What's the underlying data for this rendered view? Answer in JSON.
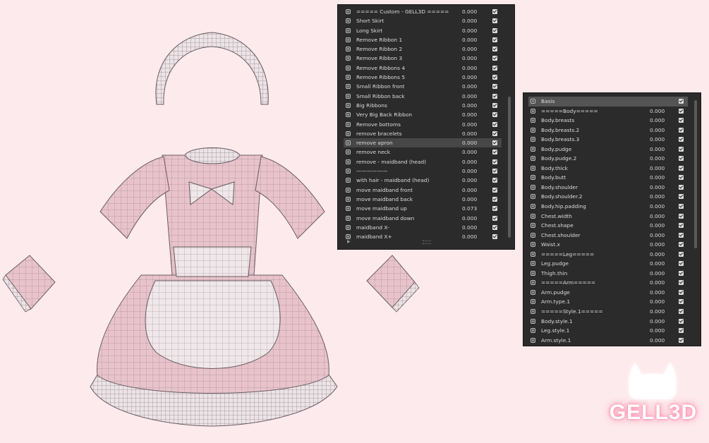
{
  "panel_left": {
    "rows": [
      {
        "name": "===== Custom - GELL3D =====",
        "value": "0.000"
      },
      {
        "name": "Short Skirt",
        "value": "0.000"
      },
      {
        "name": "Long Skirt",
        "value": "0.000"
      },
      {
        "name": "Remove Ribbon 1",
        "value": "0.000"
      },
      {
        "name": "Remove Ribbon 2",
        "value": "0.000"
      },
      {
        "name": "Remove Ribbon 3",
        "value": "0.000"
      },
      {
        "name": "Remove Ribbons 4",
        "value": "0.000"
      },
      {
        "name": "Remove Ribbons 5",
        "value": "0.000"
      },
      {
        "name": "Small Ribbon front",
        "value": "0.000"
      },
      {
        "name": "Small Ribbon back",
        "value": "0.000"
      },
      {
        "name": "Big Ribbons",
        "value": "0.000"
      },
      {
        "name": "Very Big Back Ribbon",
        "value": "0.000"
      },
      {
        "name": "Remove bottoms",
        "value": "0.000"
      },
      {
        "name": "remove bracelets",
        "value": "0.000"
      },
      {
        "name": "remove apron",
        "value": "0.000",
        "highlight": true
      },
      {
        "name": "remove neck",
        "value": "0.000"
      },
      {
        "name": "remove - maidband (head)",
        "value": "0.000"
      },
      {
        "name": "——————",
        "value": "0.000"
      },
      {
        "name": "with hair - maidband (head)",
        "value": "0.000"
      },
      {
        "name": "move maidband front",
        "value": "0.000"
      },
      {
        "name": "move maidband back",
        "value": "0.000"
      },
      {
        "name": "move maidband up",
        "value": "0.073"
      },
      {
        "name": "move maidband down",
        "value": "0.000"
      },
      {
        "name": "maidband X-",
        "value": "0.000"
      },
      {
        "name": "maidband X+",
        "value": "0.000"
      }
    ]
  },
  "panel_right": {
    "rows": [
      {
        "name": "Basis",
        "value": "",
        "selected": true
      },
      {
        "name": "=====Body=====",
        "value": "0.000"
      },
      {
        "name": "Body.breasts",
        "value": "0.000"
      },
      {
        "name": "Body.breasts.2",
        "value": "0.000"
      },
      {
        "name": "Body.breasts.3",
        "value": "0.000"
      },
      {
        "name": "Body.pudge",
        "value": "0.000"
      },
      {
        "name": "Body.pudge.2",
        "value": "0.000"
      },
      {
        "name": "Body.thick",
        "value": "0.000"
      },
      {
        "name": "Body.butt",
        "value": "0.000"
      },
      {
        "name": "Body.shoulder",
        "value": "0.000"
      },
      {
        "name": "Body.shoulder.2",
        "value": "0.000"
      },
      {
        "name": "Body.hip.padding",
        "value": "0.000"
      },
      {
        "name": "Chest.width",
        "value": "0.000"
      },
      {
        "name": "Chest.shape",
        "value": "0.000"
      },
      {
        "name": "Chest.shoulder",
        "value": "0.000"
      },
      {
        "name": "Waist.x",
        "value": "0.000"
      },
      {
        "name": "=====Leg=====",
        "value": "0.000"
      },
      {
        "name": "Leg.pudge",
        "value": "0.000"
      },
      {
        "name": "Thigh.thin",
        "value": "0.000"
      },
      {
        "name": "=====Arm=====",
        "value": "0.000"
      },
      {
        "name": "Arm.pudge",
        "value": "0.000"
      },
      {
        "name": "Arm.type.1",
        "value": "0.000"
      },
      {
        "name": "=====Style.1=====",
        "value": "0.000"
      },
      {
        "name": "Body.style.1",
        "value": "0.000"
      },
      {
        "name": "Leg.style.1",
        "value": "0.000"
      },
      {
        "name": "Arm.style.1",
        "value": "0.000"
      }
    ]
  },
  "logo": {
    "text": "GELL3D"
  },
  "colors": {
    "background": "#fdeaec",
    "panel": "#2b2b2b",
    "dress_pink": "#e9c2cc",
    "apron": "#efe6e8",
    "glow": "#ff8fb0"
  }
}
